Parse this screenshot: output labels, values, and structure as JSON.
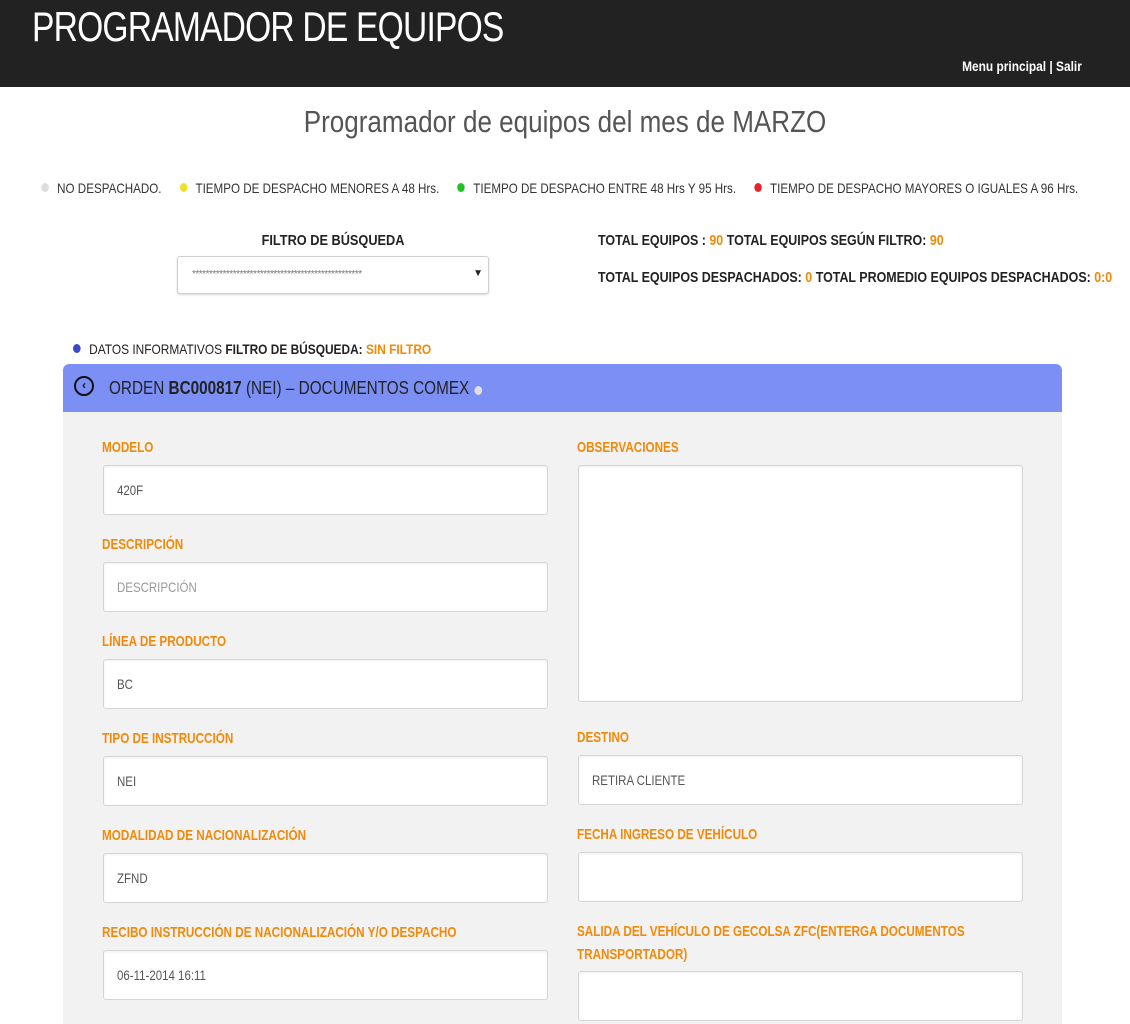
{
  "header": {
    "app_title": "PROGRAMADOR DE EQUIPOS",
    "nav_menu": "Menu principal",
    "nav_separator": "|",
    "nav_exit": "Salir"
  },
  "page": {
    "heading": "Programador de equipos del mes de MARZO"
  },
  "legend": [
    {
      "label": "NO DESPACHADO.",
      "color": "#dddddd"
    },
    {
      "label": "TIEMPO DE DESPACHO MENORES A 48 Hrs.",
      "color": "#f2e024"
    },
    {
      "label": "TIEMPO DE DESPACHO ENTRE 48 Hrs Y 95 Hrs.",
      "color": "#1ec41e"
    },
    {
      "label": "TIEMPO DE DESPACHO MAYORES O IGUALES A 96 Hrs.",
      "color": "#e8232b"
    }
  ],
  "filter": {
    "label": "FILTRO DE BÚSQUEDA",
    "selected": "**************************************************"
  },
  "totals": {
    "total_equipos_label": "TOTAL EQUIPOS :",
    "total_equipos_value": "90",
    "total_filtro_label": "TOTAL EQUIPOS SEGÚN FILTRO:",
    "total_filtro_value": "90",
    "despachados_label": "TOTAL EQUIPOS DESPACHADOS:",
    "despachados_value": "0",
    "promedio_label": "TOTAL PROMEDIO EQUIPOS DESPACHADOS:",
    "promedio_value": "0:0"
  },
  "info": {
    "prefix": "DATOS INFORMATIVOS",
    "filter_label": "FILTRO DE BÚSQUEDA:",
    "filter_value": "SIN FILTRO",
    "dot_color": "#3b48c9"
  },
  "order": {
    "prefix": "ORDEN",
    "code": "BC000817",
    "suffix": "(NEI) – DOCUMENTOS COMEX"
  },
  "fields": {
    "modelo": {
      "label": "MODELO",
      "value": "420F"
    },
    "descripcion": {
      "label": "DESCRIPCIÓN",
      "placeholder": "DESCRIPCIÓN"
    },
    "linea": {
      "label": "LÍNEA DE PRODUCTO",
      "value": "BC"
    },
    "tipo": {
      "label": "TIPO DE INSTRUCCIÓN",
      "value": "NEI"
    },
    "modalidad": {
      "label": "MODALIDAD DE NACIONALIZACIÓN",
      "value": "ZFND"
    },
    "recibo": {
      "label": "RECIBO INSTRUCCIÓN DE NACIONALIZACIÓN Y/O DESPACHO",
      "value": "06-11-2014 16:11"
    },
    "observaciones": {
      "label": "OBSERVACIONES",
      "value": ""
    },
    "destino": {
      "label": "DESTINO",
      "value": "RETIRA CLIENTE"
    },
    "fecha_ingreso": {
      "label": "FECHA INGRESO DE VEHÍCULO",
      "value": ""
    },
    "salida_line1": "SALIDA DEL VEHÍCULO DE GECOLSA ZFC(ENTERGA DOCUMENTOS",
    "salida_line2": "TRANSPORTADOR)",
    "salida_value": ""
  },
  "colors": {
    "accent": "#f08a0a",
    "header_bg": "#222222",
    "panel_header": "#7b8ff5"
  }
}
